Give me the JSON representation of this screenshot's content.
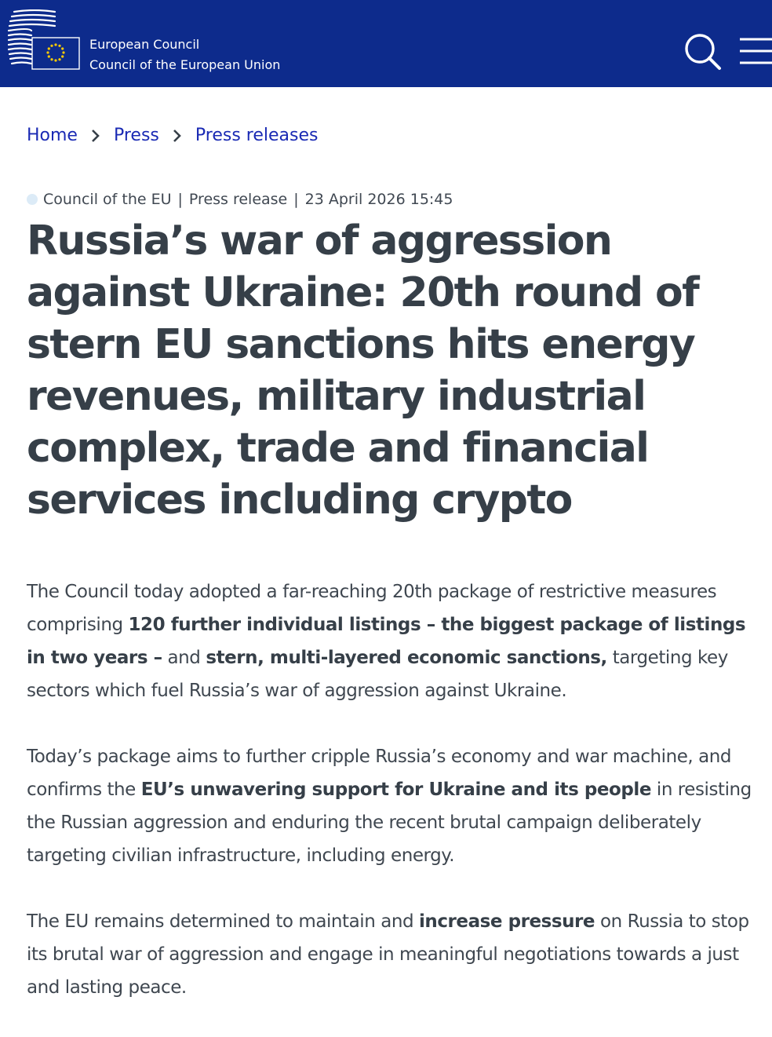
{
  "header": {
    "org_line1": "European Council",
    "org_line2": "Council of the European Union",
    "logo_icon": "eu-council-logo-icon",
    "search_icon": "search-icon",
    "menu_icon": "hamburger-menu-icon",
    "background_color": "#0d2b8c"
  },
  "breadcrumb": {
    "items": [
      {
        "label": "Home"
      },
      {
        "label": "Press"
      },
      {
        "label": "Press releases"
      }
    ],
    "separator_icon": "chevron-right-icon",
    "link_color": "#1a2ab4"
  },
  "meta": {
    "source": "Council of the EU",
    "type": "Press release",
    "date": "23 April 2026 15:45"
  },
  "article": {
    "title": "Russia’s war of aggression against Ukraine: 20th round of stern EU sanctions hits energy revenues, military industrial complex, trade and financial services including crypto",
    "paragraphs": [
      {
        "segments": [
          {
            "text": "The Council today adopted a far-reaching 20th package of restrictive measures comprising ",
            "bold": false
          },
          {
            "text": "120 further individual listings – the biggest package of listings in two years –",
            "bold": true
          },
          {
            "text": " and ",
            "bold": false
          },
          {
            "text": "stern, multi-layered economic sanctions,",
            "bold": true
          },
          {
            "text": " targeting key sectors which fuel Russia’s war of aggression against Ukraine.",
            "bold": false
          }
        ]
      },
      {
        "segments": [
          {
            "text": "Today’s package aims to further cripple Russia’s economy and war machine, and confirms the ",
            "bold": false
          },
          {
            "text": "EU’s unwavering support for Ukraine and its people",
            "bold": true
          },
          {
            "text": " in resisting the Russian aggression and enduring the recent brutal campaign deliberately targeting civilian infrastructure, including energy.",
            "bold": false
          }
        ]
      },
      {
        "segments": [
          {
            "text": "The EU remains determined to maintain and ",
            "bold": false
          },
          {
            "text": "increase pressure",
            "bold": true
          },
          {
            "text": " on Russia to stop its brutal war of aggression and engage in meaningful negotiations towards a just and lasting peace.",
            "bold": false
          }
        ]
      }
    ]
  }
}
